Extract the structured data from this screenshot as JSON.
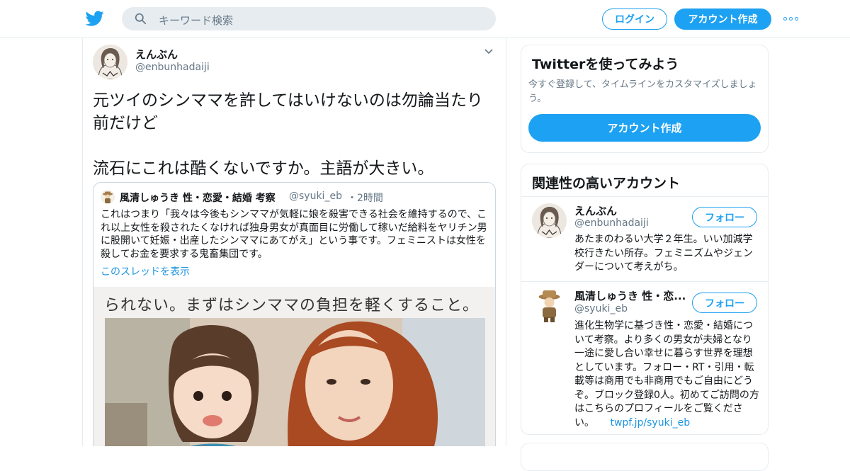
{
  "nav": {
    "search_placeholder": "キーワード検索",
    "login_label": "ログイン",
    "signup_label": "アカウント作成",
    "brand_color": "#1DA1F2"
  },
  "tweet": {
    "author_name": "えんぶん",
    "author_handle": "@enbunhadaiji",
    "text": "元ツイのシンママを許してはいけないのは勿論当たり前だけど\n\n流石にこれは酷くないですか。主語が大きい。",
    "quoted": {
      "author_name": "風清しゅうき 性・恋愛・結婚 考察",
      "author_handle": "@syuki_eb",
      "time": "・2時間",
      "text": "これはつまり「我々は今後もシンママが気軽に娘を殺害できる社会を維持するので、これ以上女性を殺されたくなければ独身男女が真面目に労働して稼いだ給料をヤリチン男に股開いて妊娠・出産したシンママにあてがえ」という事です。フェミニストは女性を殺してお金を要求する鬼畜集団です。",
      "thread_link": "このスレッドを表示",
      "image_caption": "られない。まずはシンママの負担を軽くすること。"
    }
  },
  "sidebar": {
    "signup_card": {
      "title": "Twitterを使ってみよう",
      "subtitle": "今すぐ登録して、タイムラインをカスタマイズしましょう。",
      "button_label": "アカウント作成"
    },
    "related": {
      "title": "関連性の高いアカウント",
      "accounts": [
        {
          "name": "えんぶん",
          "handle": "@enbunhadaiji",
          "bio": "あたまのわるい大学２年生。いい加減学校行きたい所存。フェミニズムやジェンダーについて考えがち。",
          "follow_label": "フォロー"
        },
        {
          "name": "風清しゅうき 性・恋...",
          "handle": "@syuki_eb",
          "bio": "進化生物学に基づき性・恋愛・結婚について考察。より多くの男女が夫婦となり一途に愛し合い幸せに暮らす世界を理想としています。フォロー・RT・引用・転載等は商用でも非商用でもご自由にどうぞ。ブロック登録0人。初めてご訪問の方はこちらのプロフィールをご覧ください。",
          "bio_link": "twpf.jp/syuki_eb",
          "follow_label": "フォロー"
        }
      ]
    }
  }
}
